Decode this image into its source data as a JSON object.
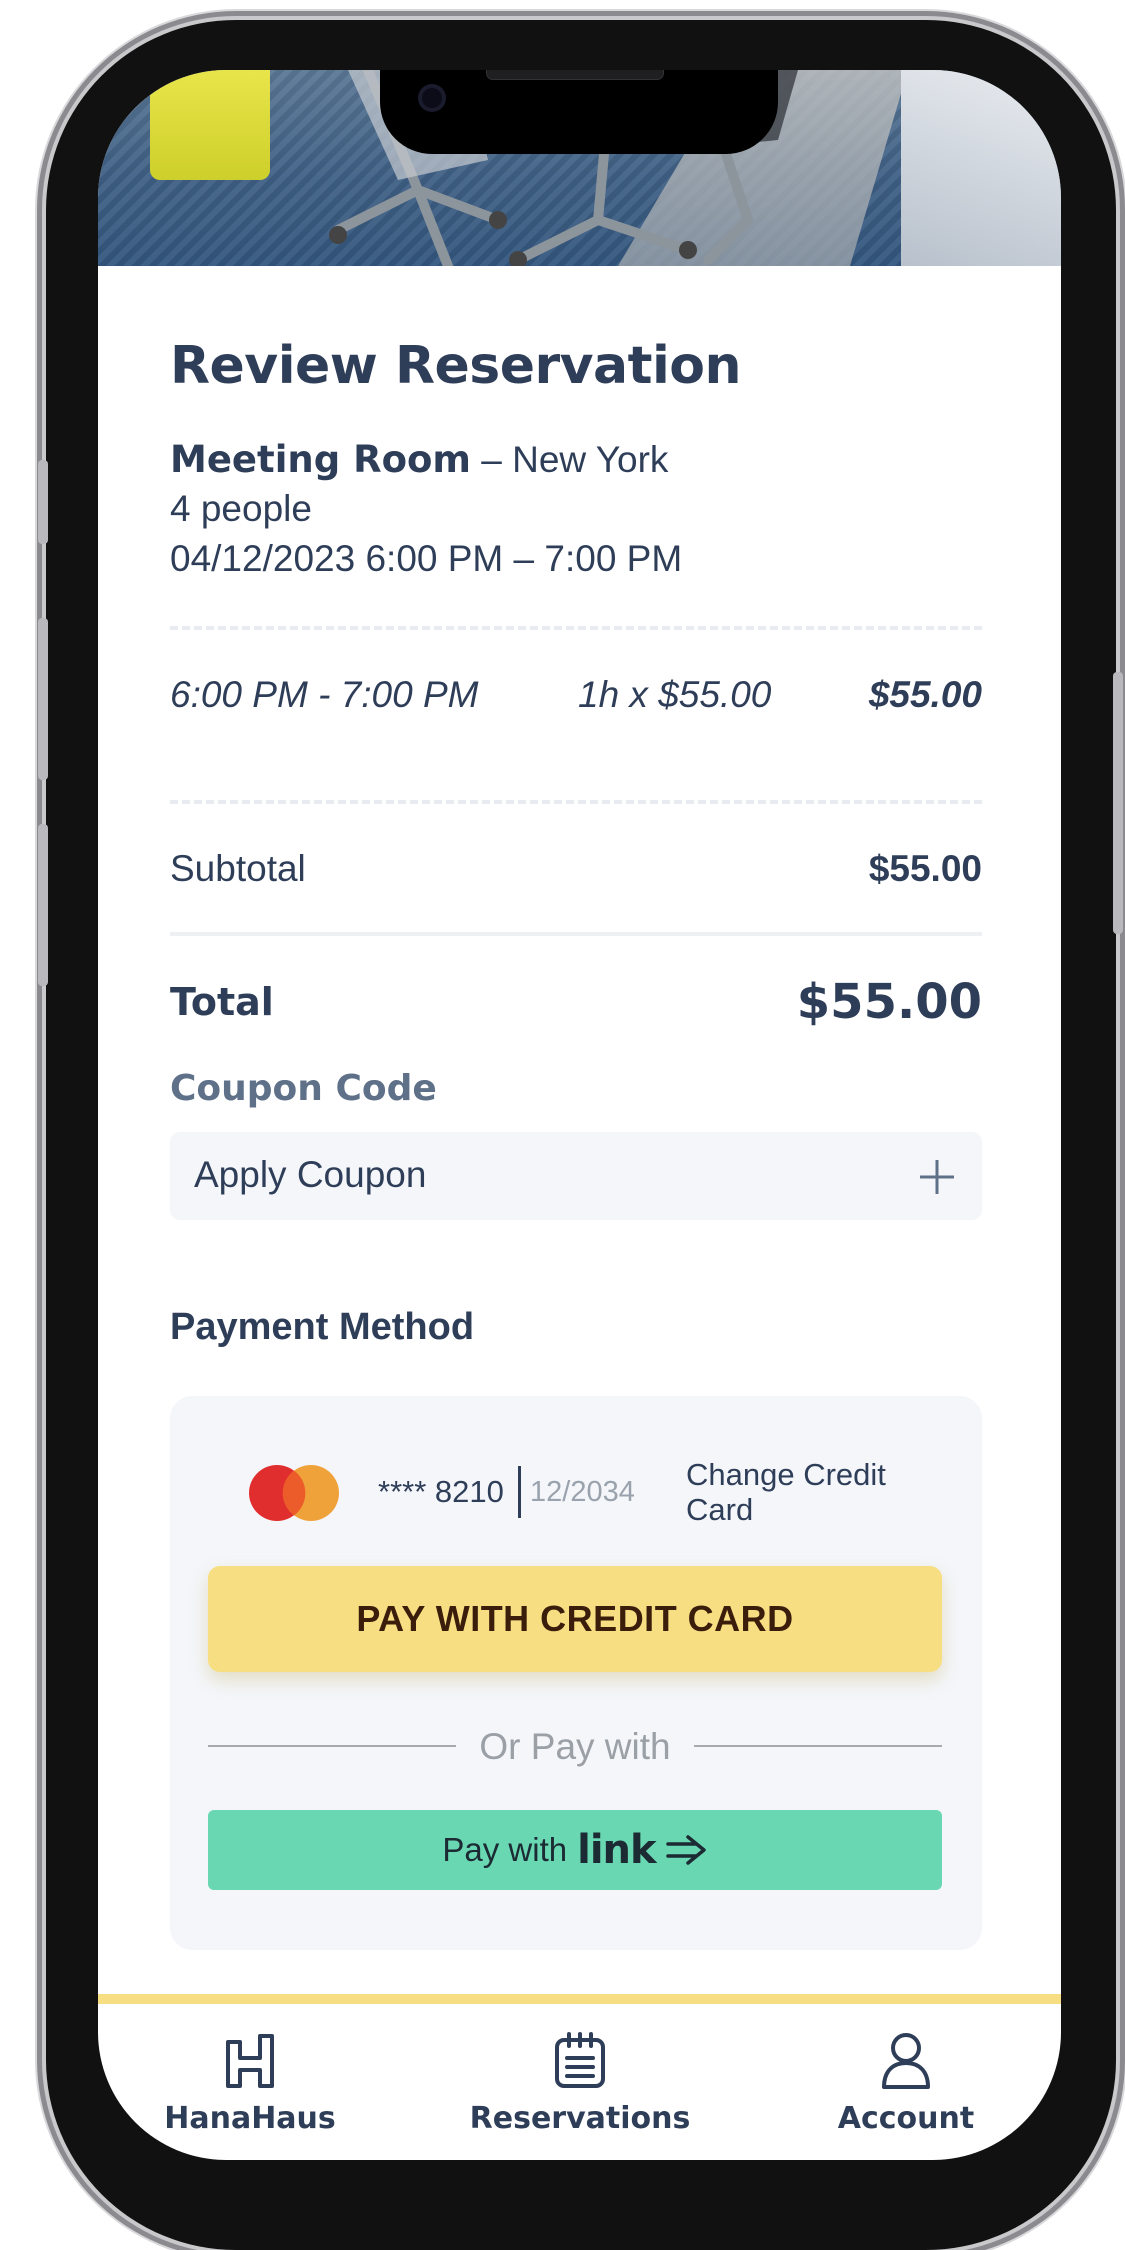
{
  "page": {
    "title": "Review Reservation"
  },
  "reservation": {
    "room_type": "Meeting Room",
    "separator": "–",
    "location": "New York",
    "people": "4 people",
    "datetime": "04/12/2023 6:00 PM – 7:00 PM"
  },
  "line_item": {
    "time_range": "6:00 PM - 7:00 PM",
    "rate": "1h x $55.00",
    "amount": "$55.00"
  },
  "totals": {
    "subtotal_label": "Subtotal",
    "subtotal_value": "$55.00",
    "total_label": "Total",
    "total_value": "$55.00"
  },
  "coupon": {
    "heading": "Coupon Code",
    "button_label": "Apply Coupon",
    "add_icon": "plus-icon"
  },
  "payment": {
    "heading": "Payment Method",
    "card_brand_icon": "mastercard-icon",
    "card_number": "**** 8210",
    "card_expiry": "12/2034",
    "change_card_label_line1": "Change Credit",
    "change_card_label_line2": "Card",
    "pay_button_label": "PAY WITH CREDIT CARD",
    "or_label": "Or Pay with",
    "link_button_prefix": "Pay with",
    "link_button_brand": "link",
    "link_arrow_icon": "arrow-right-icon"
  },
  "bottom_nav": {
    "items": [
      {
        "label": "HanaHaus",
        "icon": "building-icon"
      },
      {
        "label": "Reservations",
        "icon": "calendar-icon"
      },
      {
        "label": "Account",
        "icon": "user-icon"
      }
    ]
  },
  "colors": {
    "text_primary": "#2f3e58",
    "text_muted": "#5f7089",
    "accent_yellow": "#f8de82",
    "link_green": "#69d7b1",
    "mastercard_red": "#e02e2e",
    "mastercard_orange": "#f0a23a",
    "panel_bg": "#f4f6fa"
  }
}
